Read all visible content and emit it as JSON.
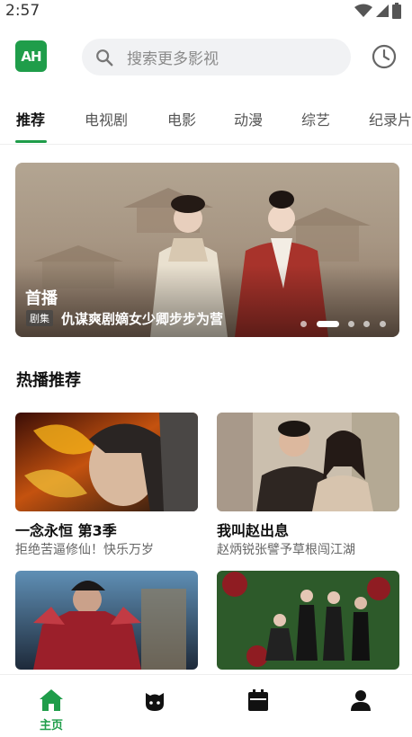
{
  "status_bar": {
    "time": "2:57"
  },
  "header": {
    "logo_text": "AH",
    "search_placeholder": "搜索更多影视"
  },
  "tabs": [
    {
      "label": "推荐",
      "active": true
    },
    {
      "label": "电视剧",
      "active": false
    },
    {
      "label": "电影",
      "active": false
    },
    {
      "label": "动漫",
      "active": false
    },
    {
      "label": "综艺",
      "active": false
    },
    {
      "label": "纪录片",
      "active": false
    }
  ],
  "banner": {
    "title": "首播",
    "tag": "剧集",
    "subtitle": "仇谋爽剧嫡女少卿步步为营",
    "slide_count": 5,
    "active_slide": 1
  },
  "hot_section": {
    "title": "热播推荐",
    "cards": [
      {
        "title": "一念永恒 第3季",
        "subtitle": "拒绝苦逼修仙！快乐万岁"
      },
      {
        "title": "我叫赵出息",
        "subtitle": "赵炳锐张譬予草根闯江湖"
      },
      {
        "title": "",
        "subtitle": ""
      },
      {
        "title": "",
        "subtitle": ""
      }
    ]
  },
  "bottom_nav": [
    {
      "label": "主页",
      "icon": "home-icon",
      "active": true
    },
    {
      "label": "",
      "icon": "anime-face-icon",
      "active": false
    },
    {
      "label": "",
      "icon": "calendar-icon",
      "active": false
    },
    {
      "label": "",
      "icon": "profile-icon",
      "active": false
    }
  ],
  "colors": {
    "accent": "#1f9d4a",
    "search_bg": "#f1f2f4"
  }
}
